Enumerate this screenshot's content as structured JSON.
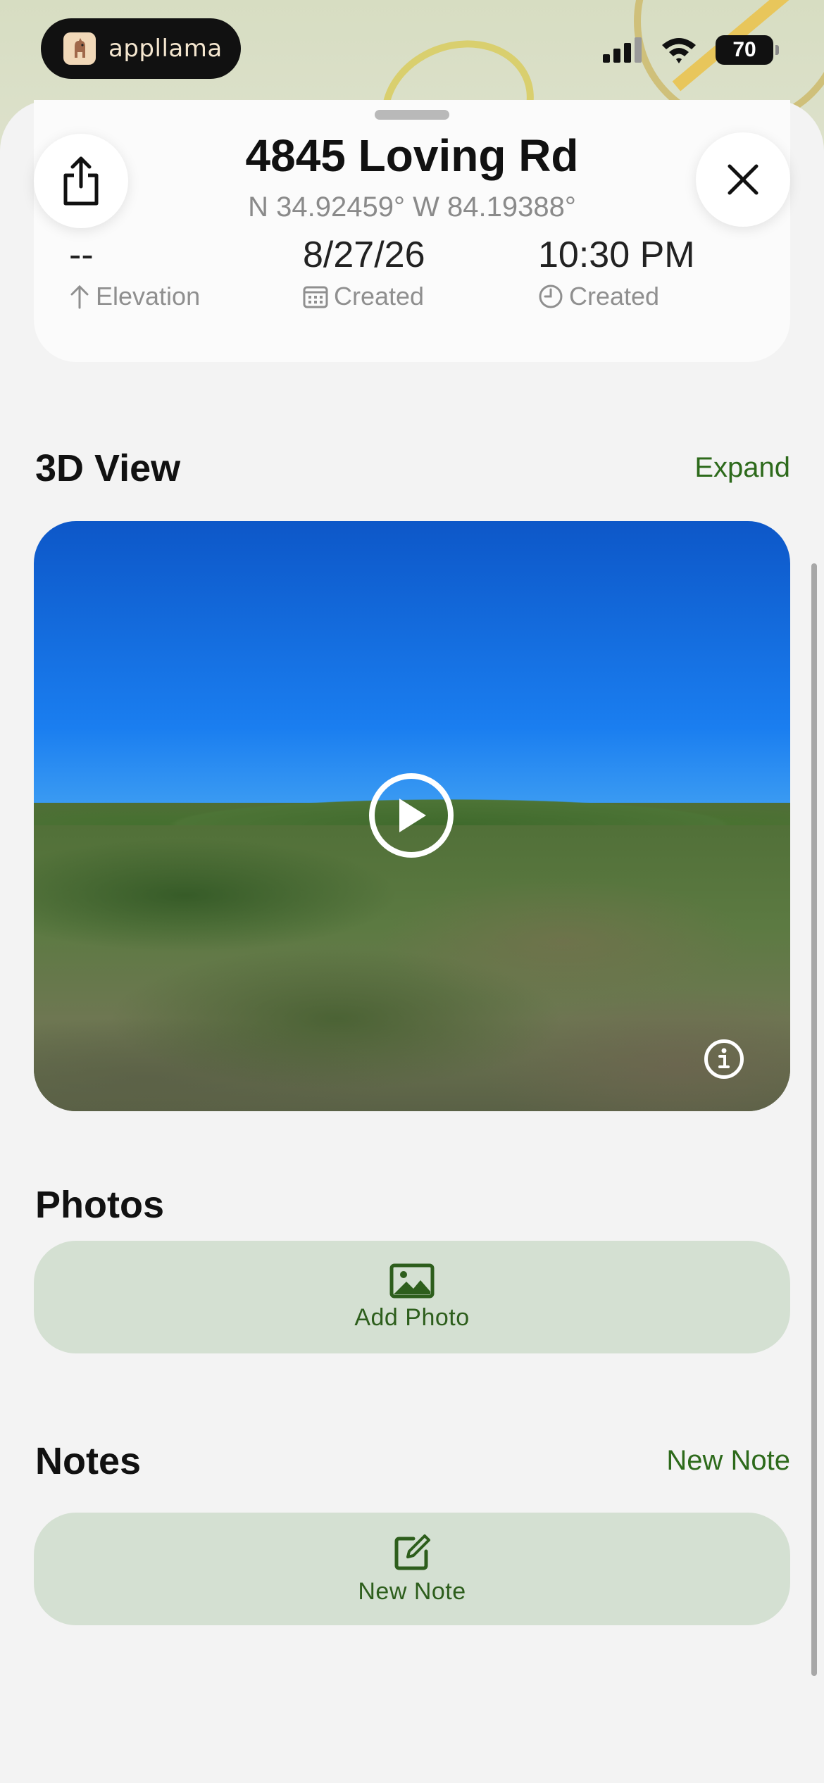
{
  "status_bar": {
    "app_name": "appllama",
    "battery": "70"
  },
  "header": {
    "title": "4845 Loving Rd",
    "coordinates": "N 34.92459° W 84.19388°"
  },
  "stats": [
    {
      "value": "--",
      "label": "Elevation",
      "icon": "arrow-up-icon"
    },
    {
      "value": "8/27/26",
      "label": "Created",
      "icon": "calendar-icon"
    },
    {
      "value": "10:30 PM",
      "label": "Created",
      "icon": "clock-icon"
    }
  ],
  "view3d": {
    "title": "3D View",
    "expand_label": "Expand"
  },
  "photos": {
    "title": "Photos",
    "add_label": "Add Photo"
  },
  "notes": {
    "title": "Notes",
    "new_note_link": "New Note",
    "new_note_label": "New Note"
  },
  "colors": {
    "accent": "#2d6a1b",
    "card_green": "#d4e0d2",
    "background": "#f3f3f3"
  }
}
